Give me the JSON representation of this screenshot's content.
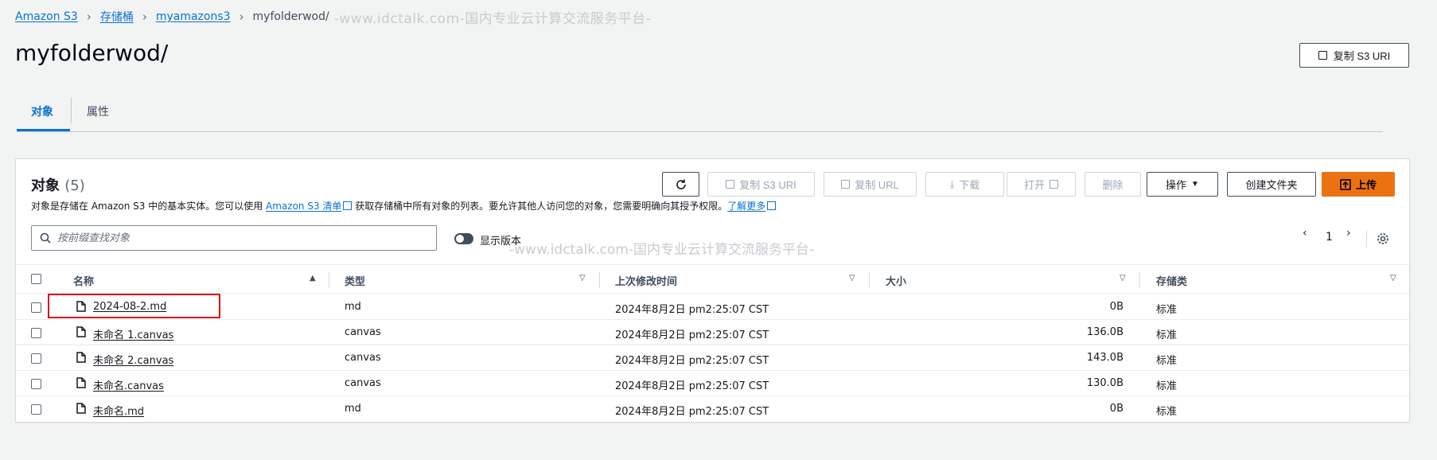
{
  "breadcrumb": {
    "items": [
      "Amazon S3",
      "存储桶",
      "myamazons3"
    ],
    "current": "myfolderwod/",
    "watermark": "-www.idctalk.com-国内专业云计算交流服务平台-"
  },
  "header": {
    "title": "myfolderwod/",
    "copy_uri": "复制 S3 URI"
  },
  "tabs": [
    {
      "label": "对象",
      "active": true
    },
    {
      "label": "属性",
      "active": false
    }
  ],
  "objects_panel": {
    "title": "对象",
    "count": "(5)",
    "description": {
      "before": "对象是存储在 Amazon S3 中的基本实体。您可以使用 ",
      "link1": "Amazon S3 清单",
      "middle": " 获取存储桶中所有对象的列表。要允许其他人访问您的对象，您需要明确向其授予权限。",
      "link2": "了解更多"
    },
    "toolbar": {
      "refresh": "refresh",
      "copy_s3_uri": "复制 S3 URI",
      "copy_url": "复制 URL",
      "download": "下载",
      "open": "打开",
      "delete": "删除",
      "actions": "操作",
      "create_folder": "创建文件夹",
      "upload": "上传"
    },
    "search_placeholder": "按前缀查找对象",
    "show_versions": "显示版本",
    "page": "1",
    "watermark": "-www.idctalk.com-国内专业云计算交流服务平台-",
    "columns": [
      "名称",
      "类型",
      "上次修改时间",
      "大小",
      "存储类"
    ],
    "rows": [
      {
        "name": "2024-08-2.md",
        "type": "md",
        "modified": "2024年8月2日 pm2:25:07 CST",
        "size": "0B",
        "storage": "标准"
      },
      {
        "name": "未命名 1.canvas",
        "type": "canvas",
        "modified": "2024年8月2日 pm2:25:07 CST",
        "size": "136.0B",
        "storage": "标准"
      },
      {
        "name": "未命名 2.canvas",
        "type": "canvas",
        "modified": "2024年8月2日 pm2:25:07 CST",
        "size": "143.0B",
        "storage": "标准"
      },
      {
        "name": "未命名.canvas",
        "type": "canvas",
        "modified": "2024年8月2日 pm2:25:07 CST",
        "size": "130.0B",
        "storage": "标准"
      },
      {
        "name": "未命名.md",
        "type": "md",
        "modified": "2024年8月2日 pm2:25:07 CST",
        "size": "0B",
        "storage": "标准"
      }
    ]
  },
  "colors": {
    "link": "#0972d3",
    "primary": "#ec7211",
    "highlight": "#d91515"
  }
}
